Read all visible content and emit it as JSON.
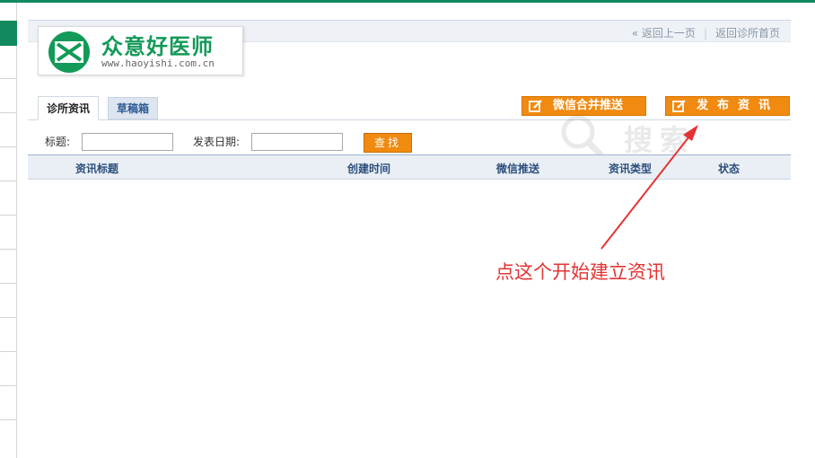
{
  "header": {
    "back_link": "« 返回上一页",
    "separator": "|",
    "home_link": "返回诊所首页"
  },
  "logo": {
    "name": "众意好医师",
    "url": "www.haoyishi.com.cn"
  },
  "tabs": [
    {
      "label": "诊所资讯",
      "active": true
    },
    {
      "label": "草稿箱",
      "active": false
    }
  ],
  "actions": {
    "wechat_push_label": "微信合并推送",
    "publish_label": "发布资讯"
  },
  "search": {
    "title_label": "标题:",
    "title_value": "",
    "date_label": "发表日期:",
    "date_value": "",
    "find_label": "查找"
  },
  "watermark": "搜索",
  "table": {
    "columns": [
      "资讯标题",
      "创建时间",
      "微信推送",
      "资讯类型",
      "状态"
    ],
    "rows": []
  },
  "annotation": "点这个开始建立资讯",
  "colors": {
    "brand_green": "#138a5e",
    "logo_green": "#139a58",
    "accent_orange": "#f08a10",
    "annotation_red": "#e53333",
    "tab_blue": "#2d5a92"
  },
  "icons": {
    "logo": "envelope-x-logo-icon",
    "button_icon": "edit-pencil-icon",
    "watermark": "search-magnifier-icon"
  }
}
